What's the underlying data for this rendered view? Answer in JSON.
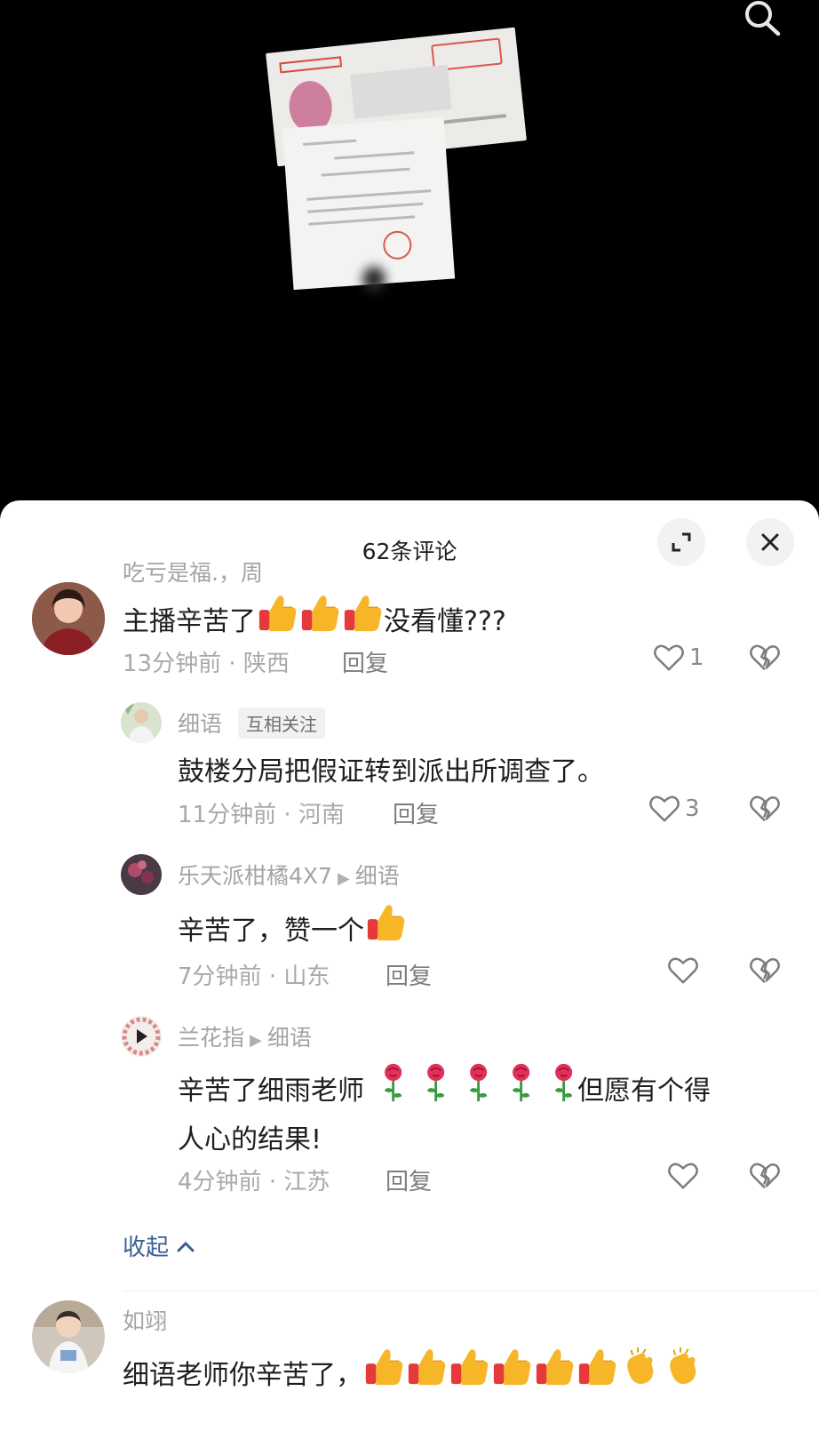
{
  "header": {
    "comment_count": "62条评论"
  },
  "comments": [
    {
      "username": "吃亏是福.，周",
      "content_text": "主播辛苦了",
      "content_suffix": "没看懂???",
      "time": "13分钟前",
      "location": "陕西",
      "reply_label": "回复",
      "likes": "1"
    }
  ],
  "replies": [
    {
      "username": "细语",
      "badge": "互相关注",
      "content": "鼓楼分局把假证转到派出所调查了。",
      "time": "11分钟前",
      "location": "河南",
      "reply_label": "回复",
      "likes": "3"
    },
    {
      "username": "乐天派柑橘4X7",
      "reply_to": "细语",
      "content": "辛苦了，赞一个",
      "time": "7分钟前",
      "location": "山东",
      "reply_label": "回复",
      "likes": ""
    },
    {
      "username": "兰花指",
      "reply_to": "细语",
      "content_line1_a": "辛苦了细雨老师",
      "content_line1_b": "但愿有个得",
      "content_line2": "人心的结果!",
      "time": "4分钟前",
      "location": "江苏",
      "reply_label": "回复",
      "likes": ""
    }
  ],
  "collapse_label": "收起",
  "next_comment": {
    "username": "如翊",
    "content_text": "细语老师你辛苦了，"
  },
  "separator": "·",
  "icons": {
    "search": "search-icon",
    "expand": "expand-icon",
    "close": "close-icon",
    "like": "heart-icon",
    "dislike": "broken-heart-icon",
    "reply_arrow": "triangle-right-icon",
    "thumbs_up": "thumbs-up-emoji",
    "clap": "clapping-hands-emoji",
    "rose": "rose-emoji",
    "collapse": "chevron-up-icon"
  },
  "colors": {
    "link_blue": "#3b5f92",
    "thumb_yellow": "#f6b628",
    "cuff_red": "#e63a3a",
    "rose_red": "#e0315a"
  }
}
